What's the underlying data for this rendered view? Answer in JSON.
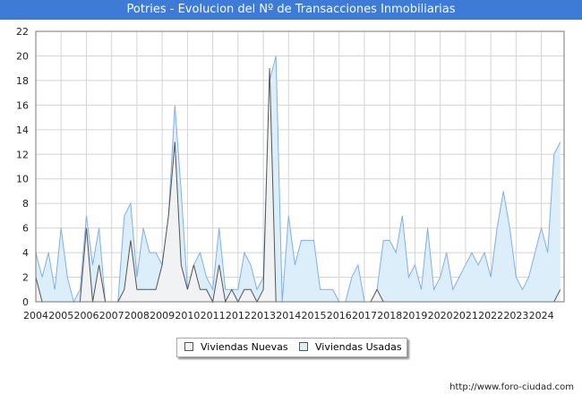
{
  "title": "Potries - Evolucion del Nº de Transacciones Inmobiliarias",
  "source": "http://www.foro-ciudad.com",
  "chart_data": {
    "type": "area",
    "title": "Potries - Evolucion del Nº de Transacciones Inmobiliarias",
    "xlabel": "",
    "ylabel": "",
    "x_ticks": [
      "2004",
      "2005",
      "2006",
      "2007",
      "2008",
      "2009",
      "2010",
      "2011",
      "2012",
      "2013",
      "2014",
      "2015",
      "2016",
      "2017",
      "2018",
      "2019",
      "2020",
      "2021",
      "2022",
      "2023",
      "2024"
    ],
    "x_range": [
      2004,
      2024.9
    ],
    "ylim": [
      0,
      22
    ],
    "y_ticks": [
      0,
      2,
      4,
      6,
      8,
      10,
      12,
      14,
      16,
      18,
      20,
      22
    ],
    "grid": true,
    "legend_position": "bottom-center",
    "series": [
      {
        "name": "Viviendas Nuevas",
        "color": "#555555",
        "fill": "#f2f2f2",
        "x": [
          2004.0,
          2004.25,
          2004.5,
          2004.75,
          2005.0,
          2005.25,
          2005.5,
          2005.75,
          2006.0,
          2006.25,
          2006.5,
          2006.75,
          2007.0,
          2007.25,
          2007.5,
          2007.75,
          2008.0,
          2008.25,
          2008.5,
          2008.75,
          2009.0,
          2009.25,
          2009.5,
          2009.75,
          2010.0,
          2010.25,
          2010.5,
          2010.75,
          2011.0,
          2011.25,
          2011.5,
          2011.75,
          2012.0,
          2012.25,
          2012.5,
          2012.75,
          2013.0,
          2013.25,
          2013.5,
          2013.75,
          2014.0,
          2014.25,
          2014.5,
          2014.75,
          2015.0,
          2015.25,
          2015.5,
          2015.75,
          2016.0,
          2016.25,
          2016.5,
          2016.75,
          2017.0,
          2017.25,
          2017.5,
          2017.75,
          2018.0,
          2018.25,
          2018.5,
          2018.75,
          2019.0,
          2019.25,
          2019.5,
          2019.75,
          2020.0,
          2020.25,
          2020.5,
          2020.75,
          2021.0,
          2021.25,
          2021.5,
          2021.75,
          2022.0,
          2022.25,
          2022.5,
          2022.75,
          2023.0,
          2023.25,
          2023.5,
          2023.75,
          2024.0,
          2024.25,
          2024.5,
          2024.75
        ],
        "values": [
          2,
          0,
          0,
          0,
          0,
          0,
          0,
          0,
          6,
          0,
          3,
          0,
          0,
          0,
          1,
          5,
          1,
          1,
          1,
          1,
          3,
          7,
          13,
          3,
          1,
          3,
          1,
          1,
          0,
          3,
          0,
          1,
          0,
          1,
          1,
          0,
          1,
          19,
          0,
          0,
          0,
          0,
          0,
          0,
          0,
          0,
          0,
          0,
          0,
          0,
          0,
          0,
          0,
          0,
          1,
          0,
          0,
          0,
          0,
          0,
          0,
          0,
          0,
          0,
          0,
          0,
          0,
          0,
          0,
          0,
          0,
          0,
          0,
          0,
          0,
          0,
          0,
          0,
          0,
          0,
          0,
          0,
          0,
          1
        ]
      },
      {
        "name": "Viviendas Usadas",
        "color": "#7fb0e6",
        "fill": "#dbeefa",
        "x": [
          2004.0,
          2004.25,
          2004.5,
          2004.75,
          2005.0,
          2005.25,
          2005.5,
          2005.75,
          2006.0,
          2006.25,
          2006.5,
          2006.75,
          2007.0,
          2007.25,
          2007.5,
          2007.75,
          2008.0,
          2008.25,
          2008.5,
          2008.75,
          2009.0,
          2009.25,
          2009.5,
          2009.75,
          2010.0,
          2010.25,
          2010.5,
          2010.75,
          2011.0,
          2011.25,
          2011.5,
          2011.75,
          2012.0,
          2012.25,
          2012.5,
          2012.75,
          2013.0,
          2013.25,
          2013.5,
          2013.75,
          2014.0,
          2014.25,
          2014.5,
          2014.75,
          2015.0,
          2015.25,
          2015.5,
          2015.75,
          2016.0,
          2016.25,
          2016.5,
          2016.75,
          2017.0,
          2017.25,
          2017.5,
          2017.75,
          2018.0,
          2018.25,
          2018.5,
          2018.75,
          2019.0,
          2019.25,
          2019.5,
          2019.75,
          2020.0,
          2020.25,
          2020.5,
          2020.75,
          2021.0,
          2021.25,
          2021.5,
          2021.75,
          2022.0,
          2022.25,
          2022.5,
          2022.75,
          2023.0,
          2023.25,
          2023.5,
          2023.75,
          2024.0,
          2024.25,
          2024.5,
          2024.75
        ],
        "values": [
          4,
          2,
          4,
          1,
          6,
          2,
          0,
          1,
          7,
          3,
          6,
          0,
          0,
          0,
          7,
          8,
          2,
          6,
          4,
          4,
          3,
          7,
          16,
          9,
          1,
          3,
          4,
          2,
          1,
          6,
          1,
          1,
          1,
          4,
          3,
          1,
          2,
          18,
          20,
          0,
          7,
          3,
          5,
          5,
          5,
          1,
          1,
          1,
          0,
          0,
          2,
          3,
          0,
          0,
          1,
          5,
          5,
          4,
          7,
          2,
          3,
          1,
          6,
          1,
          2,
          4,
          1,
          2,
          3,
          4,
          3,
          4,
          2,
          6,
          9,
          6,
          2,
          1,
          2,
          4,
          6,
          4,
          12,
          13
        ]
      }
    ]
  }
}
